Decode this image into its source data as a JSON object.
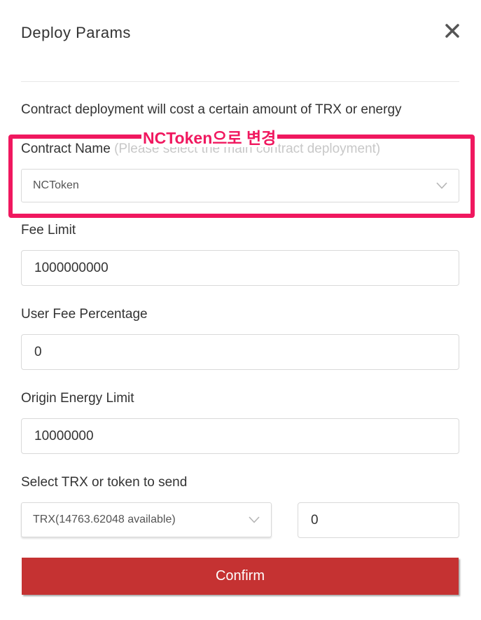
{
  "dialog": {
    "title": "Deploy Params",
    "description": "Contract deployment will cost a certain amount of TRX or energy"
  },
  "contract_name": {
    "label": "Contract Name",
    "hint": "(Please select the main contract deployment)",
    "selected": "NCToken"
  },
  "annotation": {
    "text": "NCToken으로 변경",
    "color": "#f0185f"
  },
  "fee_limit": {
    "label": "Fee Limit",
    "value": "1000000000"
  },
  "user_fee_percentage": {
    "label": "User Fee Percentage",
    "value": "0"
  },
  "origin_energy_limit": {
    "label": "Origin Energy Limit",
    "value": "10000000"
  },
  "send": {
    "label": "Select TRX or token to send",
    "token_selected": "TRX(14763.62048 available)",
    "amount": "0"
  },
  "confirm_button": {
    "label": "Confirm",
    "color": "#c53232"
  },
  "icons": {
    "close": "close-icon",
    "dropdown": "chevron-down-icon"
  }
}
